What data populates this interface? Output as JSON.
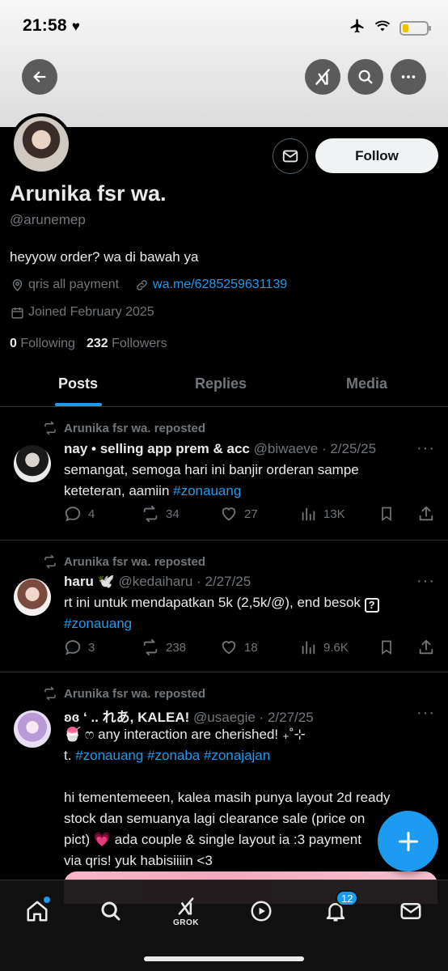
{
  "status_bar": {
    "time": "21:58"
  },
  "profile": {
    "display_name": "Arunika fsr wa.",
    "handle": "@arunemep",
    "bio": "heyyow order? wa di bawah ya",
    "location": "qris all payment",
    "link": "wa.me/6285259631139",
    "joined": "Joined February 2025",
    "following_count": "0",
    "following_label": "Following",
    "followers_count": "232",
    "followers_label": "Followers",
    "follow_button": "Follow"
  },
  "tabs": [
    {
      "label": "Posts",
      "active": true
    },
    {
      "label": "Replies",
      "active": false
    },
    {
      "label": "Media",
      "active": false
    }
  ],
  "posts": [
    {
      "repost_label": "Arunika fsr wa. reposted",
      "name": "nay • selling app prem & acc",
      "handle_date": "@biwaeve · 2/25/25",
      "text_1": "semangat, semoga hari ini banjir orderan sampe",
      "text_2": "keteteran, aamiin ",
      "hashtag": "#zonauang",
      "replies": "4",
      "reposts": "34",
      "likes": "27",
      "views": "13K"
    },
    {
      "repost_label": "Arunika fsr wa. reposted",
      "name": "haru 🕊️",
      "handle_date": "@kedaiharu · 2/27/25",
      "text_1": "rt ini untuk mendapatkan 5k (2,5k/@), end besok",
      "glyph": "?",
      "hashtag": "#zonauang",
      "replies": "3",
      "reposts": "238",
      "likes": "18",
      "views": "9.6K"
    },
    {
      "repost_label": "Arunika fsr wa. reposted",
      "name": "ʚɞ ‘ .. れあ, KALEA!",
      "handle_date": "@usaegie · 2/27/25",
      "text_1": "🍧 ෆ any interaction are cherished! ₊˚⊹",
      "text_2_prefix": "t. ",
      "hashtags": "#zonauang #zonaba #zonajajan",
      "body_1": "hi tementemeeen, kalea masih punya layout 2d ready",
      "body_2": "stock dan semuanya lagi clearance sale (price on",
      "body_3": "pict) 💗 ada couple & single layout ia :3 payment",
      "body_4": "via qris! yuk habisiiiin <3"
    }
  ],
  "bottom_nav": {
    "grok_label": "GROK",
    "notifications_count": "12"
  },
  "colors": {
    "accent": "#1d9bf0",
    "background": "#000000",
    "muted": "#71767b",
    "text": "#e7e9ea"
  }
}
